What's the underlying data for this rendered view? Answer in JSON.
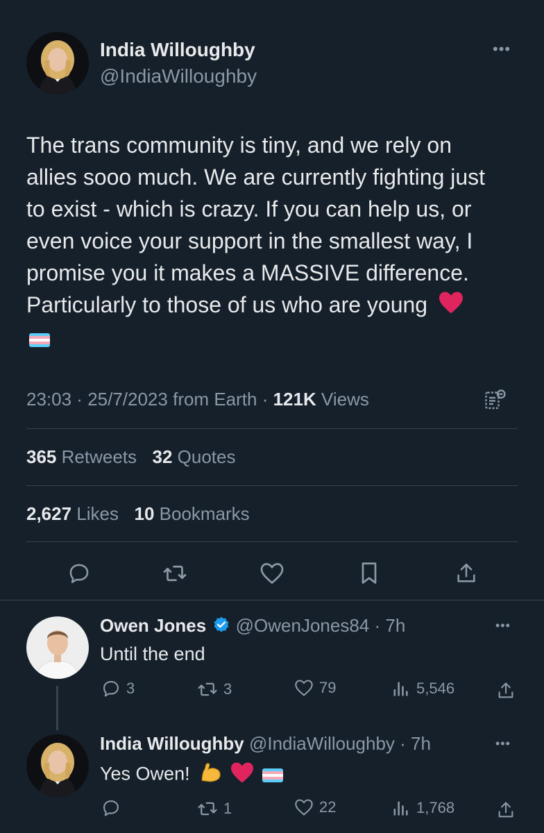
{
  "main_tweet": {
    "author_name": "India Willoughby",
    "author_handle": "@IndiaWilloughby",
    "text_lines": [
      "The trans community is tiny, and we rely on",
      "allies sooo much. We are currently fighting just",
      "to exist - which is crazy. If you can help us, or",
      "even voice your support in the smallest way, I",
      "promise you it makes a MASSIVE difference.",
      "Particularly to those of us who are young"
    ],
    "time": "23:03",
    "date": "25/7/2023",
    "source": "from Earth",
    "views_count": "121K",
    "views_label": "Views",
    "retweets_count": "365",
    "retweets_label": "Retweets",
    "quotes_count": "32",
    "quotes_label": "Quotes",
    "likes_count": "2,627",
    "likes_label": "Likes",
    "bookmarks_count": "10",
    "bookmarks_label": "Bookmarks"
  },
  "replies": [
    {
      "author_name": "Owen Jones",
      "verified": true,
      "author_handle": "@OwenJones84",
      "age": "7h",
      "text": "Until the end",
      "reply_count": "3",
      "retweet_count": "3",
      "like_count": "79",
      "view_count": "5,546"
    },
    {
      "author_name": "India Willoughby",
      "author_handle": "@IndiaWilloughby",
      "age": "7h",
      "text": "Yes Owen!",
      "reply_count": "",
      "retweet_count": "1",
      "like_count": "22",
      "view_count": "1,768"
    }
  ],
  "icons": [
    "more-icon",
    "analytics-icon",
    "reply-icon",
    "retweet-icon",
    "like-icon",
    "bookmark-icon",
    "share-icon",
    "verified-icon",
    "views-icon",
    "heart-emoji",
    "flexed-biceps-emoji",
    "trans-flag-emoji"
  ],
  "colors": {
    "background": "#15202b",
    "text": "#e7e9ea",
    "muted": "#8b98a5",
    "divider": "#38444d",
    "verified": "#1d9bf0",
    "heart": "#e0245e"
  }
}
